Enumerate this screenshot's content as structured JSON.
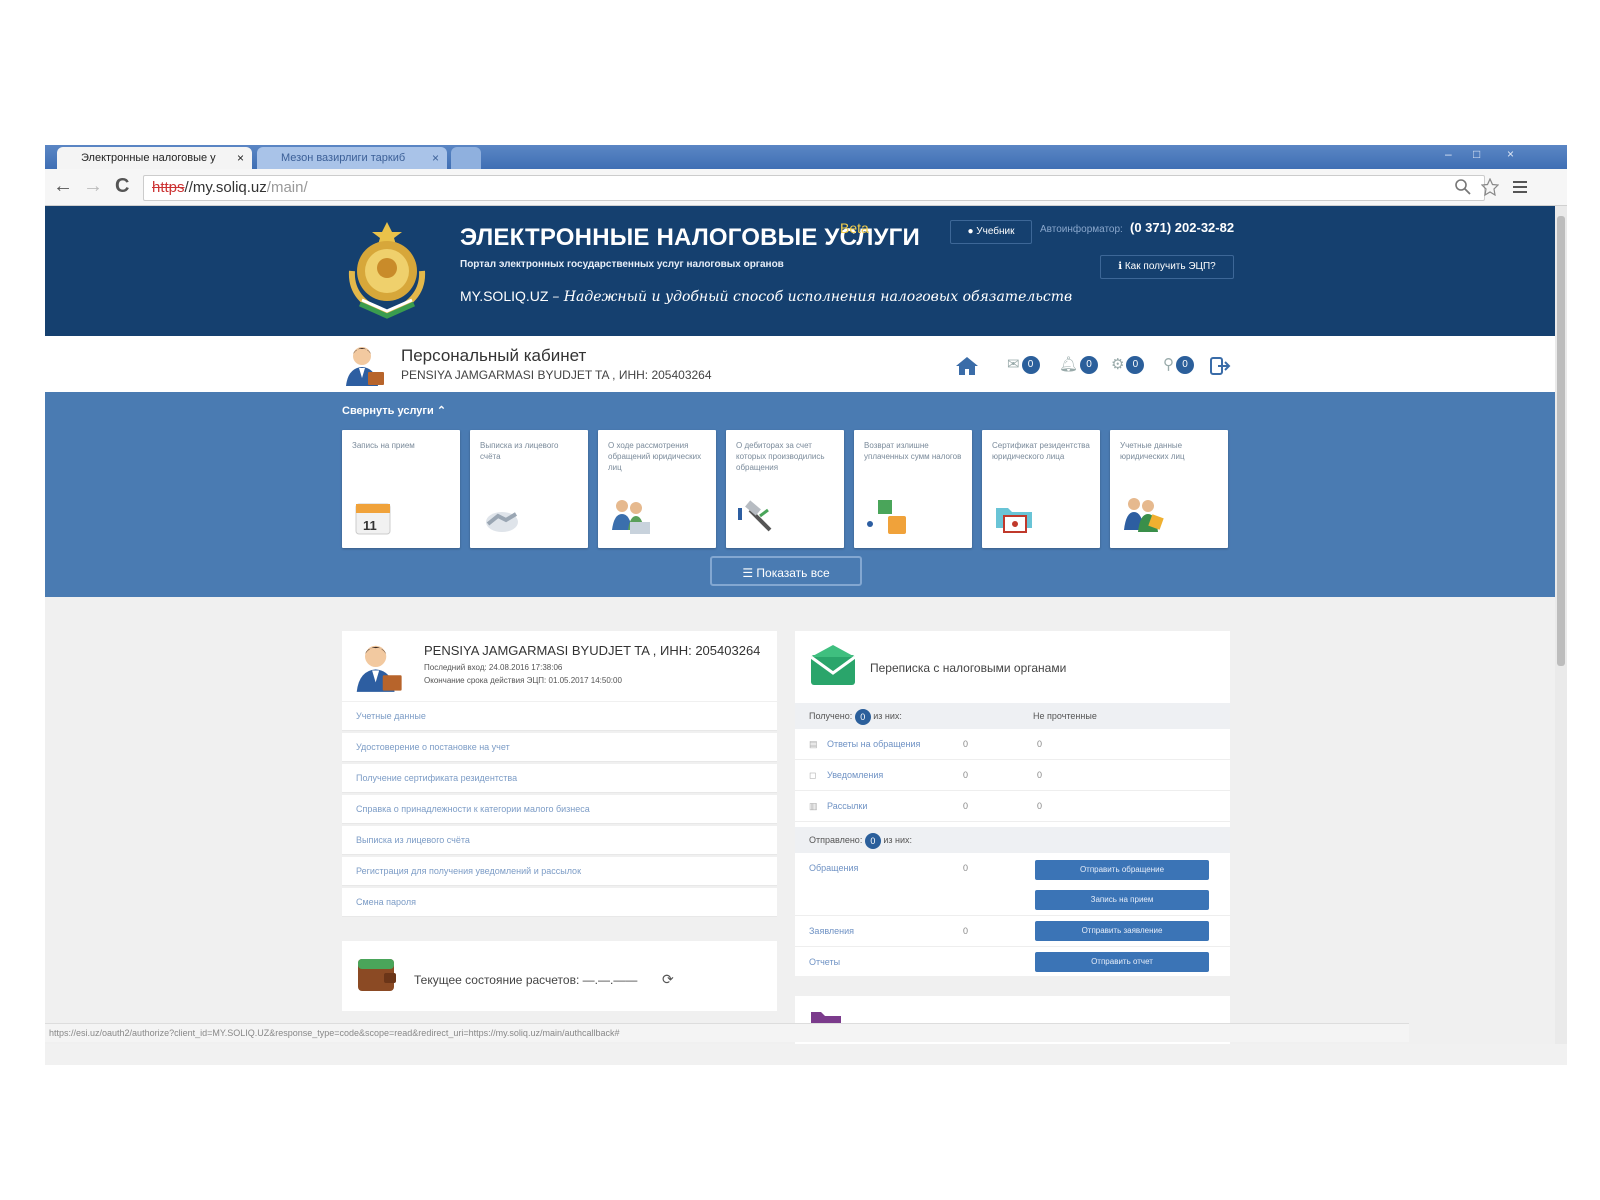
{
  "browser": {
    "tabs": [
      {
        "label": "Электронные налоговые у",
        "close": "×"
      },
      {
        "label": "Мезон вазирлиги таркиб",
        "close": "×"
      }
    ],
    "window_controls": [
      "–",
      "□",
      "×"
    ],
    "nav": {
      "back": "←",
      "forward": "→",
      "reload": "C"
    },
    "url": {
      "protocol": "https",
      "host": "//my.soliq.uz",
      "path": "/main/"
    },
    "status_url": "https://esi.uz/oauth2/authorize?client_id=MY.SOLIQ.UZ&response_type=code&scope=read&redirect_uri=https://my.soliq.uz/main/authcallback#"
  },
  "header": {
    "title": "ЭЛЕКТРОННЫЕ НАЛОГОВЫЕ УСЛУГИ",
    "beta": "Beta",
    "subtitle": "Портал электронных государственных услуг налоговых органов",
    "slogan_site": "MY.SOLIQ.UZ",
    "slogan_text": "– Надежный и удобный способ исполнения налоговых обязательств",
    "tutorial": "Учебник",
    "phone_label": "Автоинформатор:",
    "phone": "(0 371) 202-32-82",
    "ecp_link": "Как получить ЭЦП?"
  },
  "cabinet": {
    "title": "Персональный кабинет",
    "org": "PENSIYA JAMGARMASI BYUDJET TA , ИНН: 205403264",
    "counters": [
      "0",
      "0",
      "0",
      "0"
    ]
  },
  "services": {
    "collapse_label": "Свернуть услуги",
    "cards": [
      "Запись на прием",
      "Выписка из лицевого счёта",
      "О ходе рассмотрения обращений юридических лиц",
      "О дебиторах за счет которых производились обращения",
      "Возврат излишне уплаченных сумм налогов",
      "Сертификат резидентства юридического лица",
      "Учетные данные юридических лиц"
    ],
    "show_all": "Показать все"
  },
  "profile": {
    "org": "PENSIYA JAMGARMASI BYUDJET TA , ИНН: 205403264",
    "last_login": "Последний вход: 24.08.2016 17:38:06",
    "ecp_expiry": "Окончание срока действия ЭЦП: 01.05.2017 14:50:00",
    "menu": [
      "Учетные данные",
      "Удостоверение о постановке на учет",
      "Получение сертификата резидентства",
      "Справка о принадлежности к категории малого бизнеса",
      "Выписка из лицевого счёта",
      "Регистрация для получения уведомлений и рассылок",
      "Смена пароля"
    ]
  },
  "balance": {
    "label": "Текущее состояние расчетов:",
    "value": "—.—.——"
  },
  "correspondence": {
    "title": "Переписка с налоговыми органами",
    "received_label": "Получено:",
    "received_count": "0",
    "of_them": "из них:",
    "unread_label": "Не прочтенные",
    "received_rows": [
      {
        "label": "Ответы на обращения",
        "n1": "0",
        "n2": "0"
      },
      {
        "label": "Уведомления",
        "n1": "0",
        "n2": "0"
      },
      {
        "label": "Рассылки",
        "n1": "0",
        "n2": "0"
      }
    ],
    "sent_label": "Отправлено:",
    "sent_count": "0",
    "sent_rows": [
      {
        "label": "Обращения",
        "n1": "0"
      },
      {
        "label": "Заявления",
        "n1": "0"
      },
      {
        "label": "Отчеты",
        "n1": ""
      }
    ],
    "buttons": [
      "Отправить обращение",
      "Запись на прием",
      "Отправить заявление",
      "Отправить отчет"
    ]
  },
  "colors": {
    "header_bg": "#15406f",
    "services_bg": "#4a7bb2",
    "button_bg": "#3b74b6",
    "accent_green": "#2aa56b"
  }
}
